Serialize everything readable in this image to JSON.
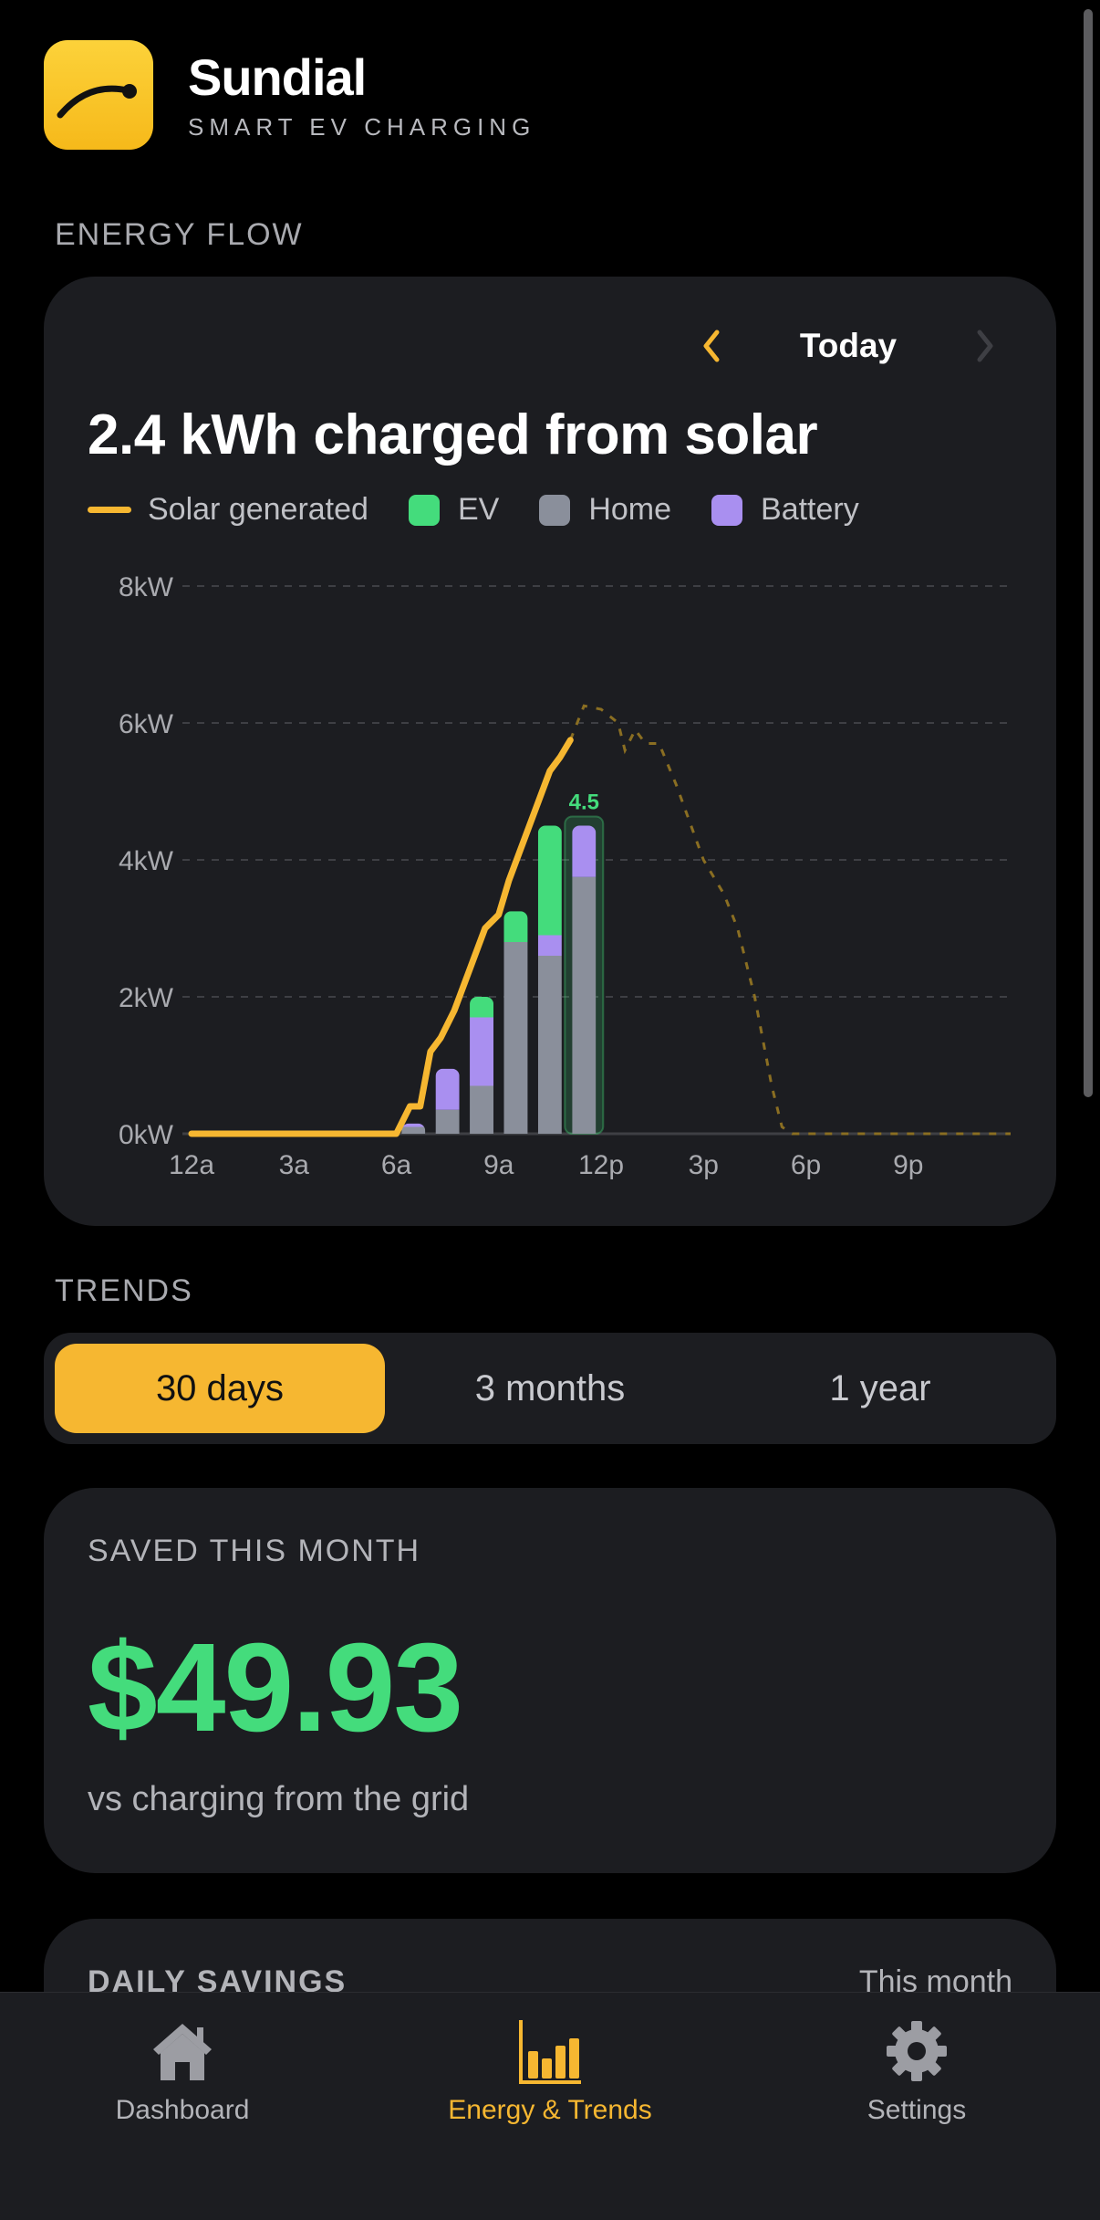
{
  "app": {
    "name": "Sundial",
    "subtitle": "SMART EV CHARGING"
  },
  "energy_flow": {
    "section_title": "ENERGY FLOW",
    "date_label": "Today",
    "headline": "2.4 kWh charged from solar",
    "legend": [
      {
        "label": "Solar generated",
        "color": "#f6b731",
        "kind": "line"
      },
      {
        "label": "EV",
        "color": "#44dc7c",
        "kind": "swatch"
      },
      {
        "label": "Home",
        "color": "#8a8f9b",
        "kind": "swatch"
      },
      {
        "label": "Battery",
        "color": "#a98ff0",
        "kind": "swatch"
      }
    ]
  },
  "chart_data": {
    "type": "bar",
    "ylim": [
      0,
      8
    ],
    "xlim": [
      0,
      24
    ],
    "y_ticks": [
      {
        "value": 8,
        "label": "8kW"
      },
      {
        "value": 6,
        "label": "6kW"
      },
      {
        "value": 4,
        "label": "4kW"
      },
      {
        "value": 2,
        "label": "2kW"
      },
      {
        "value": 0,
        "label": "0kW"
      }
    ],
    "x_ticks": [
      {
        "value": 0,
        "label": "12a"
      },
      {
        "value": 3,
        "label": "3a"
      },
      {
        "value": 6,
        "label": "6a"
      },
      {
        "value": 9,
        "label": "9a"
      },
      {
        "value": 12,
        "label": "12p"
      },
      {
        "value": 15,
        "label": "3p"
      },
      {
        "value": 18,
        "label": "6p"
      },
      {
        "value": 21,
        "label": "9p"
      }
    ],
    "grid": true,
    "bars": [
      {
        "hour": 6,
        "home": 0.1,
        "battery": 0.05,
        "ev": 0
      },
      {
        "hour": 7,
        "home": 0.35,
        "battery": 0.6,
        "ev": 0
      },
      {
        "hour": 8,
        "home": 0.7,
        "battery": 1.0,
        "ev": 0.3
      },
      {
        "hour": 9,
        "home": 2.8,
        "battery": 0,
        "ev": 0.45
      },
      {
        "hour": 10,
        "home": 2.6,
        "battery": 0.3,
        "ev": 1.6
      },
      {
        "hour": 11,
        "home": 3.75,
        "battery": 0.75,
        "ev": 0
      }
    ],
    "selected_hour": 11,
    "selected_label": "4.5",
    "solar_actual": [
      [
        0,
        0
      ],
      [
        6,
        0
      ],
      [
        6.2,
        0.2
      ],
      [
        6.4,
        0.4
      ],
      [
        6.7,
        0.4
      ],
      [
        7.0,
        1.2
      ],
      [
        7.3,
        1.4
      ],
      [
        7.7,
        1.8
      ],
      [
        8.0,
        2.2
      ],
      [
        8.3,
        2.6
      ],
      [
        8.6,
        3.0
      ],
      [
        9.0,
        3.2
      ],
      [
        9.3,
        3.7
      ],
      [
        9.6,
        4.1
      ],
      [
        9.9,
        4.5
      ],
      [
        10.2,
        4.9
      ],
      [
        10.5,
        5.3
      ],
      [
        10.8,
        5.5
      ],
      [
        11.1,
        5.75
      ]
    ],
    "solar_forecast": [
      [
        11.1,
        5.75
      ],
      [
        11.5,
        6.25
      ],
      [
        12,
        6.2
      ],
      [
        12.5,
        6.0
      ],
      [
        12.7,
        5.6
      ],
      [
        13,
        5.9
      ],
      [
        13.3,
        5.7
      ],
      [
        13.7,
        5.7
      ],
      [
        14.2,
        5.1
      ],
      [
        15,
        4.0
      ],
      [
        15.6,
        3.5
      ],
      [
        16,
        3.0
      ],
      [
        16.5,
        2.0
      ],
      [
        17,
        0.7
      ],
      [
        17.3,
        0.1
      ],
      [
        17.6,
        0
      ],
      [
        24,
        0
      ]
    ]
  },
  "trends": {
    "section_title": "TRENDS",
    "ranges": [
      "30 days",
      "3 months",
      "1 year"
    ],
    "active_range": "30 days"
  },
  "savings": {
    "label": "SAVED THIS MONTH",
    "value": "$49.93",
    "note": "vs charging from the grid"
  },
  "daily_savings": {
    "title": "DAILY SAVINGS",
    "range": "This month"
  },
  "tabbar": {
    "tabs": [
      {
        "label": "Dashboard",
        "icon": "house-icon"
      },
      {
        "label": "Energy & Trends",
        "icon": "bar-chart-icon"
      },
      {
        "label": "Settings",
        "icon": "gear-icon"
      }
    ],
    "active": "Energy & Trends"
  },
  "colors": {
    "accent": "#f6b731",
    "ev": "#44dc7c",
    "home": "#8a8f9b",
    "battery": "#a98ff0",
    "card": "#1c1d21"
  }
}
